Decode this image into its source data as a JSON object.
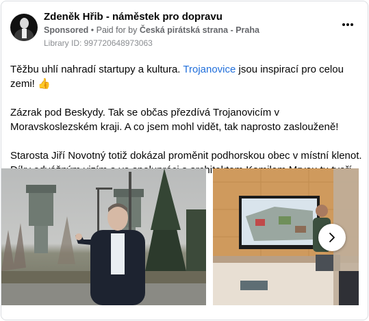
{
  "post": {
    "author": "Zdeněk Hřib - náměstek pro dopravu",
    "sponsored_label": "Sponsored",
    "paid_for_label": " • Paid for by ",
    "paid_for_by": "Česká pirátská strana - Praha",
    "library_id": "Library ID: 997720648973063",
    "more_icon": "more-horizontal-icon",
    "text_line1_before": "Těžbu uhlí nahradí startupy a kultura. ",
    "text_line1_link": "Trojanovice",
    "text_line1_after": " jsou inspirací pro celou zemi! 👍",
    "text_paragraph2": "Zázrak pod Beskydy. Tak se občas přezdívá Trojanovicím v Moravskoslezském kraji. A co jsem mohl vidět, tak naprosto zaslouženě!",
    "text_paragraph3": "Starosta Jiří Novotný totiž dokázal proměnit podhorskou obec v místní klenot. Díky odvážným vizím a ve spolupráci s architektem Kamilem Mrvou tu tvoří živé a…"
  },
  "media": {
    "next_icon": "chevron-right-icon"
  }
}
